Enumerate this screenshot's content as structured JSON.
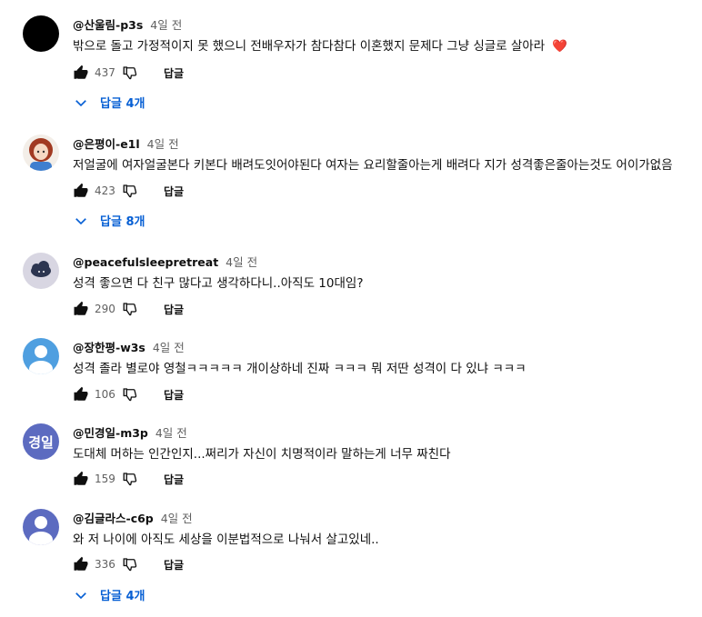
{
  "comments": [
    {
      "author": "@산울림-p3s",
      "time": "4일 전",
      "text": "밖으로 돌고 가정적이지 못 했으니  전배우자가 참다참다 이혼했지 문제다 그냥 싱글로 살아라",
      "emoji": "❤️",
      "likes": "437",
      "reply_label": "답글",
      "replies_label": "답글 4개"
    },
    {
      "author": "@은평이-e1l",
      "time": "4일 전",
      "text": "저얼굴에 여자얼굴본다 키본다 배려도잇어야된다 여자는 요리할줄아는게 배려다 지가 성격좋은줄아는것도 어이가없음",
      "likes": "423",
      "reply_label": "답글",
      "replies_label": "답글 8개"
    },
    {
      "author": "@peacefulsleepretreat",
      "time": "4일 전",
      "text": "성격 좋으면 다 친구 많다고 생각하다니..아직도 10대임?",
      "likes": "290",
      "reply_label": "답글"
    },
    {
      "author": "@장한평-w3s",
      "time": "4일 전",
      "text": "성격 졸라 별로야 영철ㅋㅋㅋㅋㅋ 개이상하네 진짜 ㅋㅋㅋ 뭐 저딴 성격이 다 있냐 ㅋㅋㅋ",
      "likes": "106",
      "reply_label": "답글"
    },
    {
      "author": "@민경일-m3p",
      "time": "4일 전",
      "avatar_text": "경일",
      "text": "도대체 머하는 인간인지...쩌리가 자신이  치명적이라 말하는게 너무 짜친다",
      "likes": "159",
      "reply_label": "답글"
    },
    {
      "author": "@김글라스-c6p",
      "time": "4일 전",
      "text": "와 저 나이에 아직도 세상을 이분법적으로 나눠서 살고있네..",
      "likes": "336",
      "reply_label": "답글",
      "replies_label": "답글 4개"
    }
  ],
  "colors": {
    "link": "#065fd4",
    "meta": "#606060",
    "heart": "#e21b1b",
    "avatar_default": "#4f9fe0",
    "avatar_purple": "#5c6bc0"
  },
  "icons": {
    "like": "thumbs-up-icon",
    "dislike": "thumbs-down-icon",
    "expand": "chevron-down-icon"
  }
}
